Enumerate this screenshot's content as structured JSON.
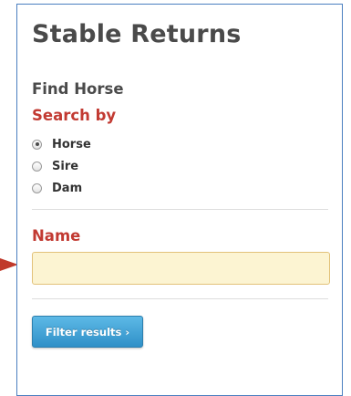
{
  "panel": {
    "title": "Stable Returns"
  },
  "find_horse": {
    "heading": "Find Horse",
    "search_by_label": "Search by",
    "options": [
      {
        "label": "Horse",
        "checked": true
      },
      {
        "label": "Sire",
        "checked": false
      },
      {
        "label": "Dam",
        "checked": false
      }
    ]
  },
  "name_field": {
    "label": "Name",
    "value": "",
    "placeholder": ""
  },
  "filter_button": {
    "label": "Filter results ›"
  },
  "colors": {
    "accent_red": "#c23a32",
    "button_blue": "#3a9fd6",
    "input_highlight": "#fcf4d2",
    "panel_border": "#4a7fc0",
    "arrow": "#c0392b"
  }
}
